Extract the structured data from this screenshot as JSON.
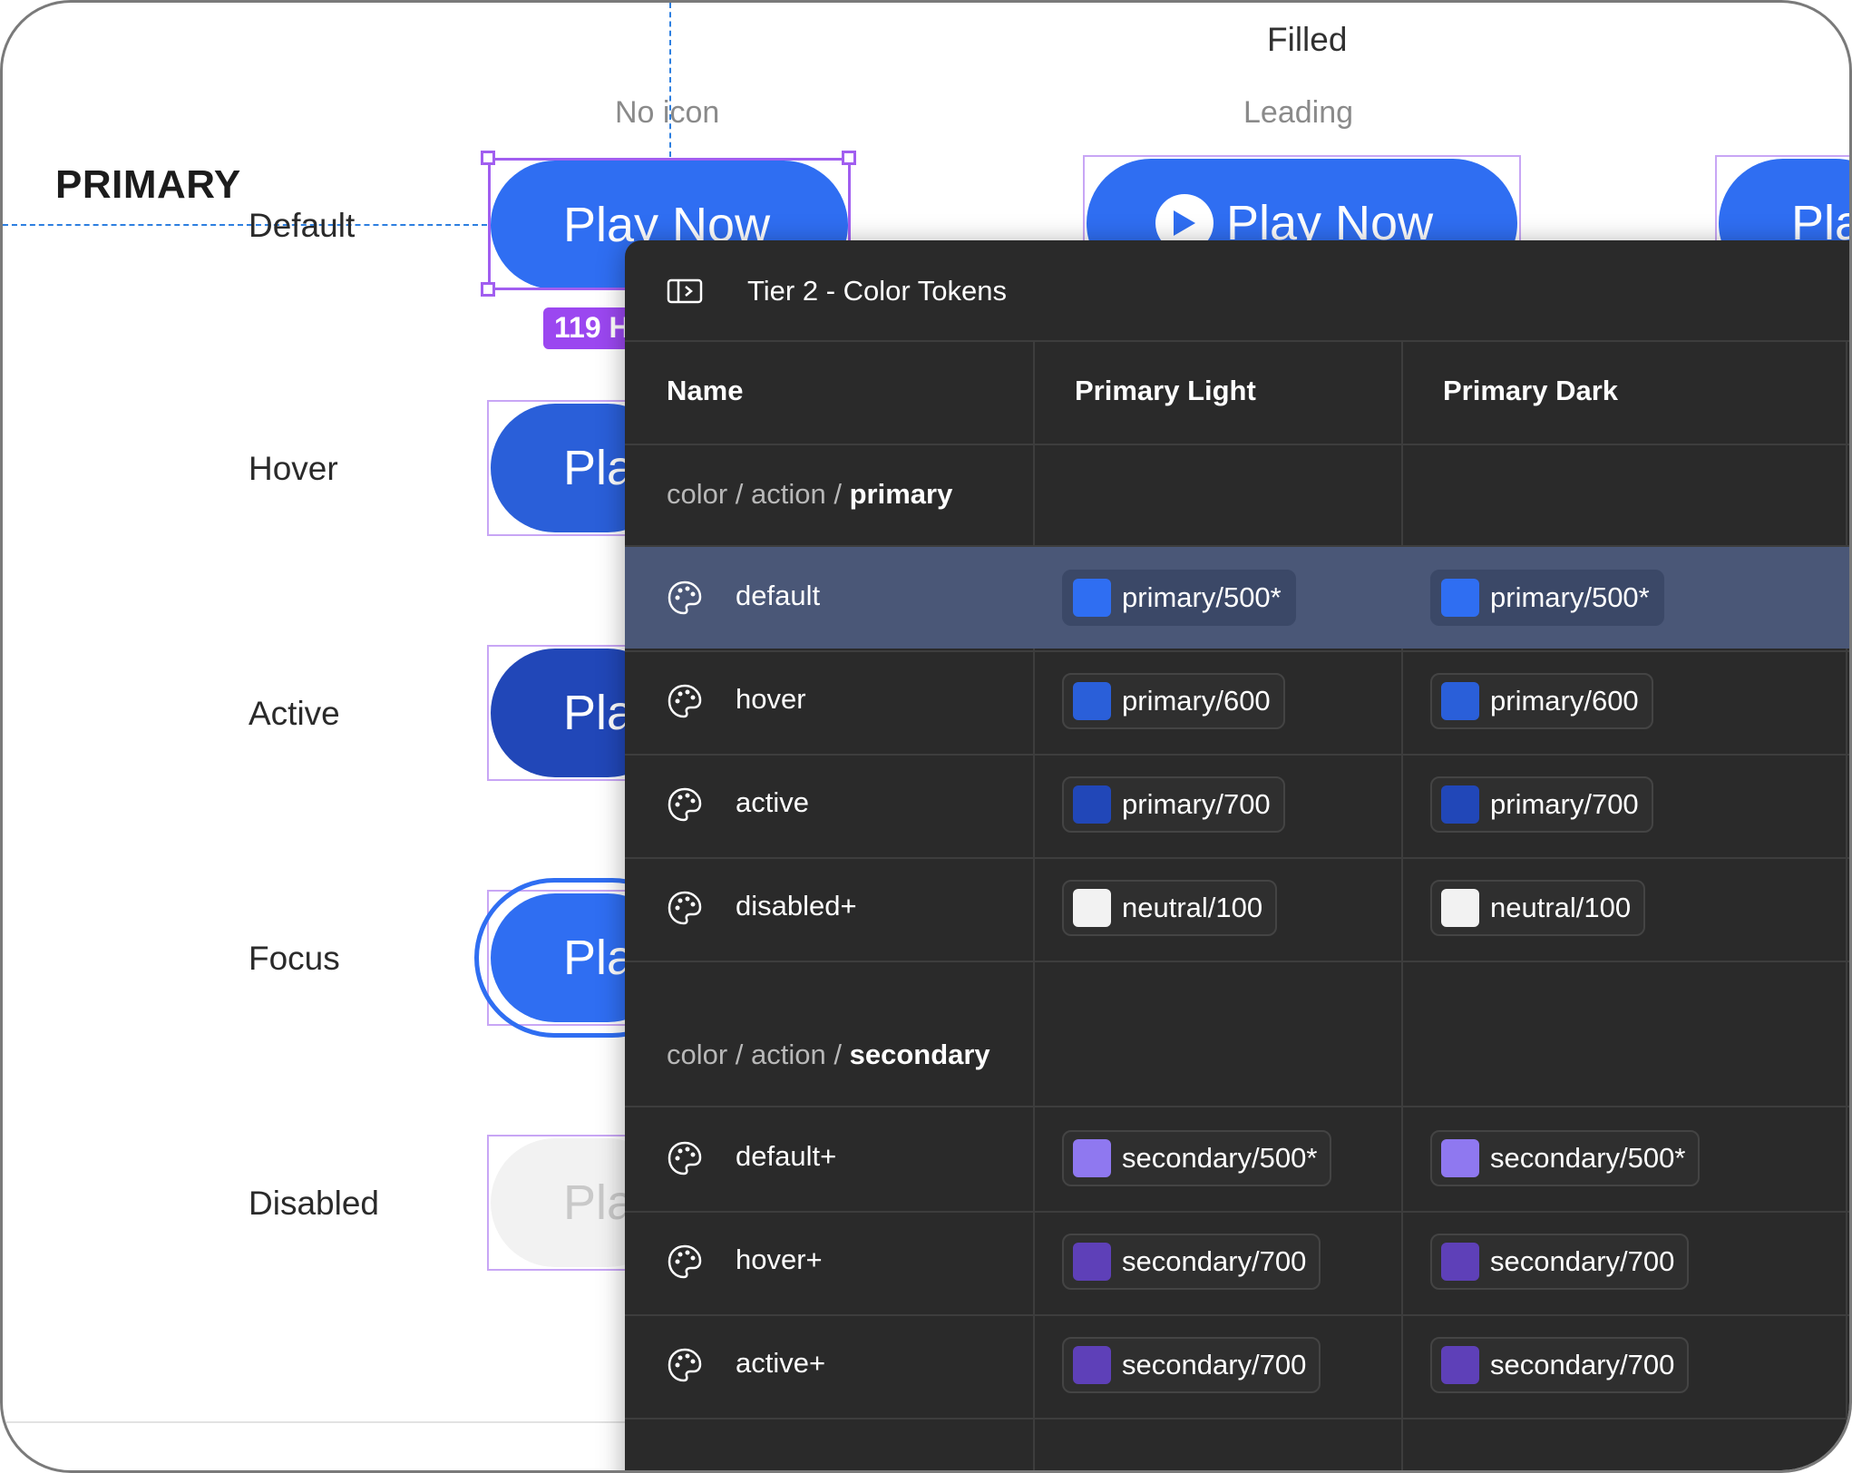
{
  "canvas": {
    "column_title": "Filled",
    "subcolumns": [
      "No icon",
      "Leading"
    ],
    "section": "PRIMARY",
    "states": [
      "Default",
      "Hover",
      "Active",
      "Focus",
      "Disabled"
    ],
    "button_label": "Play Now",
    "button_label_partial": "Pla",
    "dimension_badge": "119 H",
    "colors": {
      "default": "#2f6ef2",
      "hover": "#2a5fd9",
      "active": "#2147b8",
      "disabled": "#f2f2f2",
      "guide": "#2d7fe0",
      "selection": "#a15ef0"
    }
  },
  "panel": {
    "title": "Tier 2 - Color Tokens",
    "icon": "sidebar-toggle-icon",
    "headers": [
      "Name",
      "Primary Light",
      "Primary Dark"
    ],
    "groups": [
      {
        "prefix": "color / action / ",
        "name": "primary",
        "rows": [
          {
            "name": "default",
            "light": "primary/500*",
            "dark": "primary/500*",
            "color": "#2f6ef2",
            "selected": true
          },
          {
            "name": "hover",
            "light": "primary/600",
            "dark": "primary/600",
            "color": "#2a5fd9"
          },
          {
            "name": "active",
            "light": "primary/700",
            "dark": "primary/700",
            "color": "#2147b8"
          },
          {
            "name": "disabled+",
            "light": "neutral/100",
            "dark": "neutral/100",
            "color": "#f2f2f2"
          }
        ]
      },
      {
        "prefix": "color / action / ",
        "name": "secondary",
        "rows": [
          {
            "name": "default+",
            "light": "secondary/500*",
            "dark": "secondary/500*",
            "color": "#8f78f0"
          },
          {
            "name": "hover+",
            "light": "secondary/700",
            "dark": "secondary/700",
            "color": "#5e40b8"
          },
          {
            "name": "active+",
            "light": "secondary/700",
            "dark": "secondary/700",
            "color": "#5e40b8"
          }
        ]
      }
    ]
  }
}
